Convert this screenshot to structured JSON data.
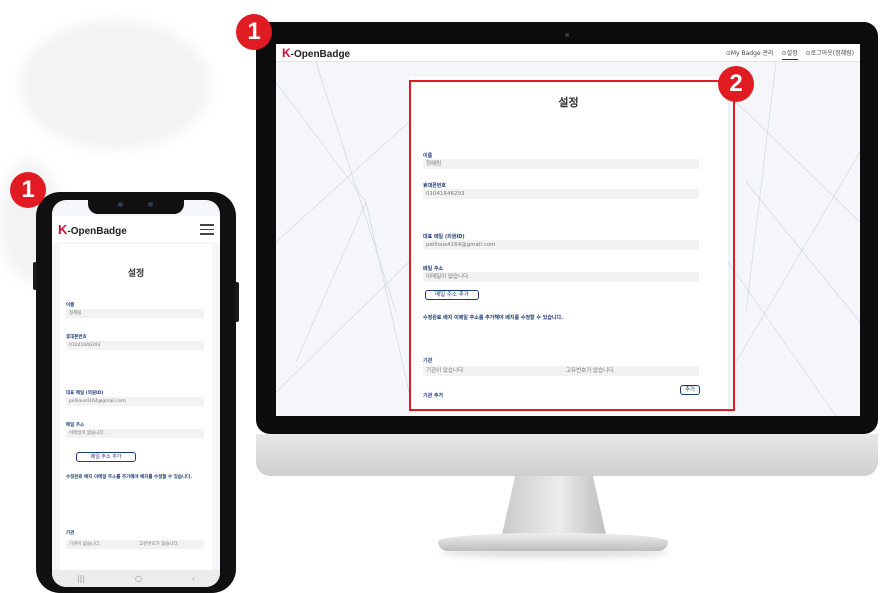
{
  "badges": {
    "monitor": "1",
    "panel": "2",
    "phone": "1"
  },
  "colors": {
    "accent": "#e11b22",
    "brand_navy": "#1d3a78",
    "logo_k": "#c8102e"
  },
  "icons": {
    "menu": "hamburger-menu-icon",
    "nav_recent": "recent-apps-icon",
    "nav_home": "home-icon",
    "nav_back": "back-icon"
  },
  "app": {
    "logo_k": "K",
    "logo_rest": "-OpenBadge"
  },
  "desktop": {
    "nav": {
      "badge_manage": "⊙My Badge 관리",
      "settings": "⊙설정",
      "logout": "⊙로그아웃(정혜림)"
    }
  },
  "settings": {
    "title": "설정",
    "name_label": "이름",
    "name_value": "정혜림",
    "phone_label": "휴대폰번호",
    "phone_value": "01041646293",
    "email_label": "대표 메일 (외원ID)",
    "email_value": "pellious4164@gmail.com",
    "mail_label": "메일 주소",
    "mail_placeholder": "이메일이 없습니다.",
    "add_mail_button": "메일 주소 추가",
    "note": "수정완료 배지 이메일 주소를 추가해야 배지를 수정할 수 있습니다.",
    "org_label": "기관",
    "org_value": "기관이 없습니다.",
    "org_code_value": "고유번호가 없습니다.",
    "add_button": "추가",
    "org_add_label": "기관 추가"
  },
  "phone_nav": {
    "recent": "|||",
    "home": "○",
    "back": "‹"
  }
}
